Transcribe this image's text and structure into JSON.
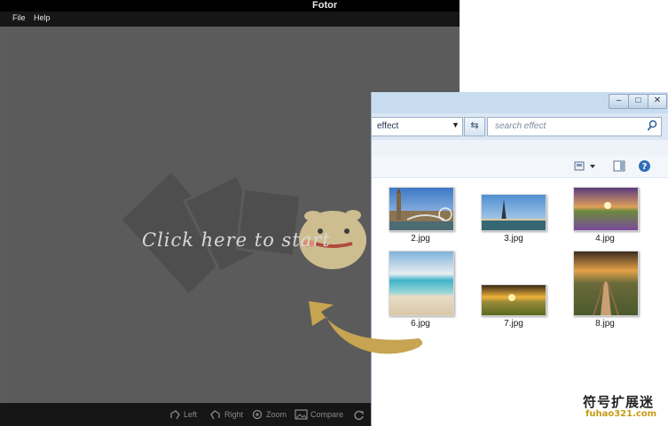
{
  "fotor": {
    "title": "Fotor",
    "menu": [
      "File",
      "Help"
    ],
    "start_prompt": "Click here to start",
    "bottom_toolbar": [
      {
        "label": "Left",
        "icon": "rotate-left-icon"
      },
      {
        "label": "Right",
        "icon": "rotate-right-icon"
      },
      {
        "label": "Zoom",
        "icon": "zoom-icon"
      },
      {
        "label": "Compare",
        "icon": "compare-icon"
      }
    ]
  },
  "explorer": {
    "window_buttons": [
      "minimize",
      "maximize",
      "close"
    ],
    "address": "effect",
    "search_placeholder": "search effect",
    "files": [
      {
        "name": "2.jpg",
        "scene": "london-big-ben"
      },
      {
        "name": "3.jpg",
        "scene": "paris-eiffel-tower"
      },
      {
        "name": "4.jpg",
        "scene": "purple-flower-field"
      },
      {
        "name": "6.jpg",
        "scene": "tropical-beach"
      },
      {
        "name": "7.jpg",
        "scene": "sunset-field"
      },
      {
        "name": "8.jpg",
        "scene": "wooden-boardwalk"
      }
    ]
  },
  "colors": {
    "fotor_bg": "#5c5c5c",
    "arrow": "#c6a451",
    "explorer_chrome": "#c8dcef",
    "watermark_accent": "#c79a12"
  },
  "watermark": {
    "line1": "符号扩展迷",
    "line2": "fuhao321.com"
  }
}
